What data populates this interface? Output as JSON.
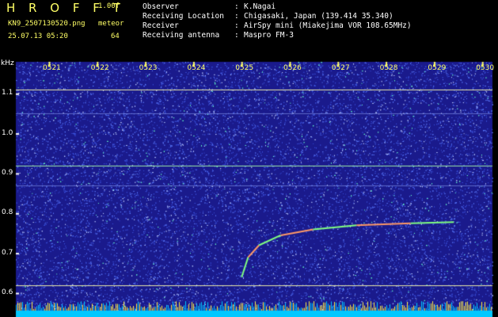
{
  "header": {
    "logo": "H R O F F T",
    "version": "1.00f",
    "filename": "KN9_2507130520.png",
    "datetime": "25.07.13 05:20",
    "meteor_label": "meteor",
    "meteor_count": "64",
    "info_rows": [
      {
        "label": "Observer",
        "value": "K.Nagai"
      },
      {
        "label": "Receiving Location",
        "value": "Chigasaki, Japan (139.414 35.340)"
      },
      {
        "label": "Receiver",
        "value": "AirSpy mini (Miakejima VOR 108.65MHz)"
      },
      {
        "label": "Receiving antenna",
        "value": "Maspro FM-3"
      }
    ],
    "colon": ":"
  },
  "chart_data": {
    "type": "heatmap",
    "ylabel": "kHz",
    "y_ticks": [
      "1.1",
      "1.0",
      "0.9",
      "0.8",
      "0.7",
      "0.6"
    ],
    "ylim": [
      0.58,
      1.18
    ],
    "x_ticks": [
      "0521",
      "0522",
      "0523",
      "0524",
      "0525",
      "0526",
      "0527",
      "0528",
      "0529",
      "0530"
    ],
    "horizontal_lines_khz": [
      1.11,
      1.05,
      0.92,
      0.87,
      0.62
    ],
    "trace": {
      "start": {
        "time": "0525",
        "khz": 0.64
      },
      "points": [
        [
          0.64,
          0.64
        ],
        [
          0.7,
          0.69
        ],
        [
          0.8,
          0.72
        ],
        [
          1.0,
          0.745
        ],
        [
          1.3,
          0.76
        ],
        [
          1.7,
          0.77
        ],
        [
          2.2,
          0.775
        ],
        [
          2.6,
          0.778
        ]
      ]
    },
    "colors": {
      "background": "#1a1a8c",
      "noise": "#5c7cff",
      "line": "#ffffaa",
      "trace": "#80ff80",
      "bottom": "#00c8ff"
    }
  }
}
